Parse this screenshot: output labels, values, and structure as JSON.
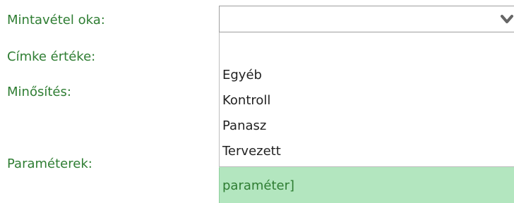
{
  "form": {
    "labels": {
      "sampling_reason": "Mintavétel oka:",
      "label_value": "Címke értéke:",
      "qualification": "Minősítés:",
      "parameters": "Paraméterek:"
    },
    "sampling_reason_select": {
      "value": "",
      "options": [
        "Egyéb",
        "Kontroll",
        "Panasz",
        "Tervezett"
      ]
    },
    "parameters_field": {
      "text": "paraméter]"
    }
  },
  "icons": {
    "select_chevron": "chevron-down-icon"
  },
  "colors": {
    "label_green": "#2e7d32",
    "parameter_box_bg": "#b3e6bf",
    "select_border": "#9e9e9e"
  }
}
